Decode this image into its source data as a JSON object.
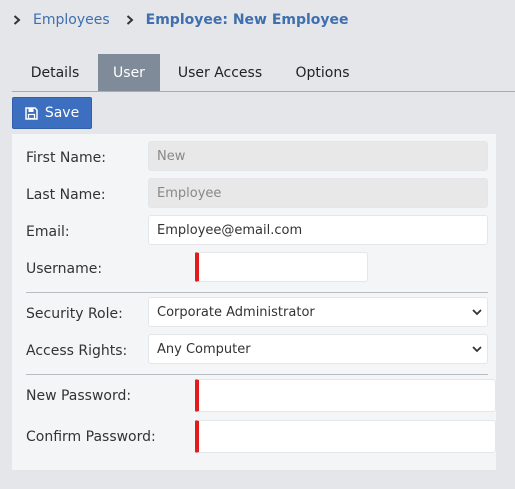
{
  "breadcrumb": {
    "parent_label": "Employees",
    "current_label": "Employee: New Employee"
  },
  "tabs": [
    {
      "label": "Details",
      "active": false
    },
    {
      "label": "User",
      "active": true
    },
    {
      "label": "User Access",
      "active": false
    },
    {
      "label": "Options",
      "active": false
    }
  ],
  "toolbar": {
    "save_label": "Save",
    "save_icon": "floppy-disk-icon"
  },
  "form": {
    "first_name": {
      "label": "First Name:",
      "value": "New",
      "disabled": true
    },
    "last_name": {
      "label": "Last Name:",
      "value": "Employee",
      "disabled": true
    },
    "email": {
      "label": "Email:",
      "value": "Employee@email.com"
    },
    "username": {
      "label": "Username:",
      "value": "",
      "required": true
    },
    "security_role": {
      "label": "Security Role:",
      "selected": "Corporate Administrator"
    },
    "access_rights": {
      "label": "Access Rights:",
      "selected": "Any Computer"
    },
    "new_password": {
      "label": "New Password:",
      "value": "",
      "required": true
    },
    "confirm_password": {
      "label": "Confirm Password:",
      "value": "",
      "required": true
    }
  },
  "colors": {
    "accent": "#3c6fbf",
    "link": "#3f6fad",
    "active_tab": "#7f8b98",
    "required_marker": "#e21b1b",
    "background": "#e4e6ea",
    "panel": "#f4f5f7"
  }
}
